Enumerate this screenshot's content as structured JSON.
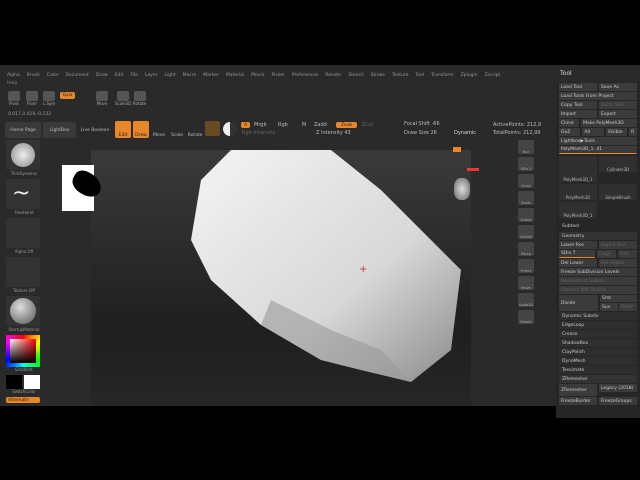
{
  "menu": [
    "Alpha",
    "Brush",
    "Color",
    "Document",
    "Draw",
    "Edit",
    "File",
    "Layer",
    "Light",
    "Macro",
    "Marker",
    "Material",
    "Movie",
    "Picker",
    "Preferences",
    "Render",
    "Stencil",
    "Stroke",
    "Texture",
    "Tool",
    "Transform",
    "Zplugin",
    "Zscript"
  ],
  "help": "Help",
  "shelf": {
    "pivot": "Pivot",
    "floor": "Floor",
    "lsym": "L.Sym",
    "qviz": "Qviz",
    "move": "Move",
    "scale": "Scale3D",
    "rotate": "Rotate"
  },
  "coords": "0.017,0.018,-0.232",
  "toolbar": {
    "home": "Home Page",
    "lightbox": "LightBox",
    "liveboolean": "Live Boolean",
    "edit": "Edit",
    "draw": "Draw",
    "move": "Move",
    "scale": "Scale",
    "rotate": "Rotate",
    "a": "A",
    "mrgb": "Mrgb",
    "rgb": "Rgb",
    "m": "M",
    "zadd": "Zadd",
    "zsub": "Zsub",
    "zcut": "Zcut",
    "rgb_intensity": "Rgb Intensity",
    "z_intensity": "Z Intensity 43",
    "focal_shift": "Focal Shift -66",
    "draw_size": "Draw Size 26",
    "dynamic": "Dynamic",
    "active_points": "ActivePoints: 212,9",
    "total_points": "TotalPoints: 212,99"
  },
  "left": {
    "brush": "TrimDynamic",
    "stroke": "FreeHand",
    "alpha": "Alpha Off",
    "texture": "Texture Off",
    "material": "StartupMaterial",
    "gradient": "Gradient",
    "switch": "SwitchColor",
    "alternate": "Alternate"
  },
  "rightbar": [
    "Bpr",
    "SPix 3",
    "Scroll",
    "Zoom",
    "Actual",
    "AAHalf",
    "Persp",
    "Frame",
    "Move",
    "Scale3D",
    "Rotate"
  ],
  "tool": {
    "title": "Tool",
    "load": "Load Tool",
    "saveas": "Save As",
    "loadproject": "Load Tools From Project",
    "copy": "Copy Tool",
    "paste": "Paste Tool",
    "import": "Import",
    "export": "Export",
    "clone": "Clone",
    "make": "Make PolyMesh3D",
    "goz": "GoZ",
    "all": "All",
    "visible": "Visible",
    "r": "R",
    "lightbox": "Lightbox▶Tools",
    "current": "PolyMesh3D_1. 41",
    "items": [
      "PolyMesh3D_1",
      "Cylinder3D",
      "PolyMesh3D",
      "SimpleBrush",
      "PolyMesh3D_1"
    ],
    "subtool": "Subtool",
    "geometry": "Geometry",
    "lower": "Lower Res",
    "higher": "Higher Res",
    "sdiv": "SDiv 7",
    "cage": "Cage",
    "rstr": "Rstr",
    "dellower": "Del Lower",
    "delhigher": "Del Higher",
    "freeze": "Freeze SubDivision Levels",
    "reconstruct": "Reconstruct Subdiv",
    "convert": "Convert BPR To Geo",
    "divide": "Divide",
    "smt": "Smt",
    "suv": "Suv",
    "reuv": "ReUV",
    "list": [
      "Dynamic Subdiv",
      "EdgeLoop",
      "Crease",
      "ShadowBox",
      "ClayPolish",
      "DynaMesh",
      "Tessimate"
    ],
    "zremesher": "ZRemesher",
    "zrem_btn": "ZRemesher",
    "legacy": "Legacy (2018)",
    "freezeborder": "FreezeBorder",
    "freezegroups": "FreezeGroups"
  }
}
